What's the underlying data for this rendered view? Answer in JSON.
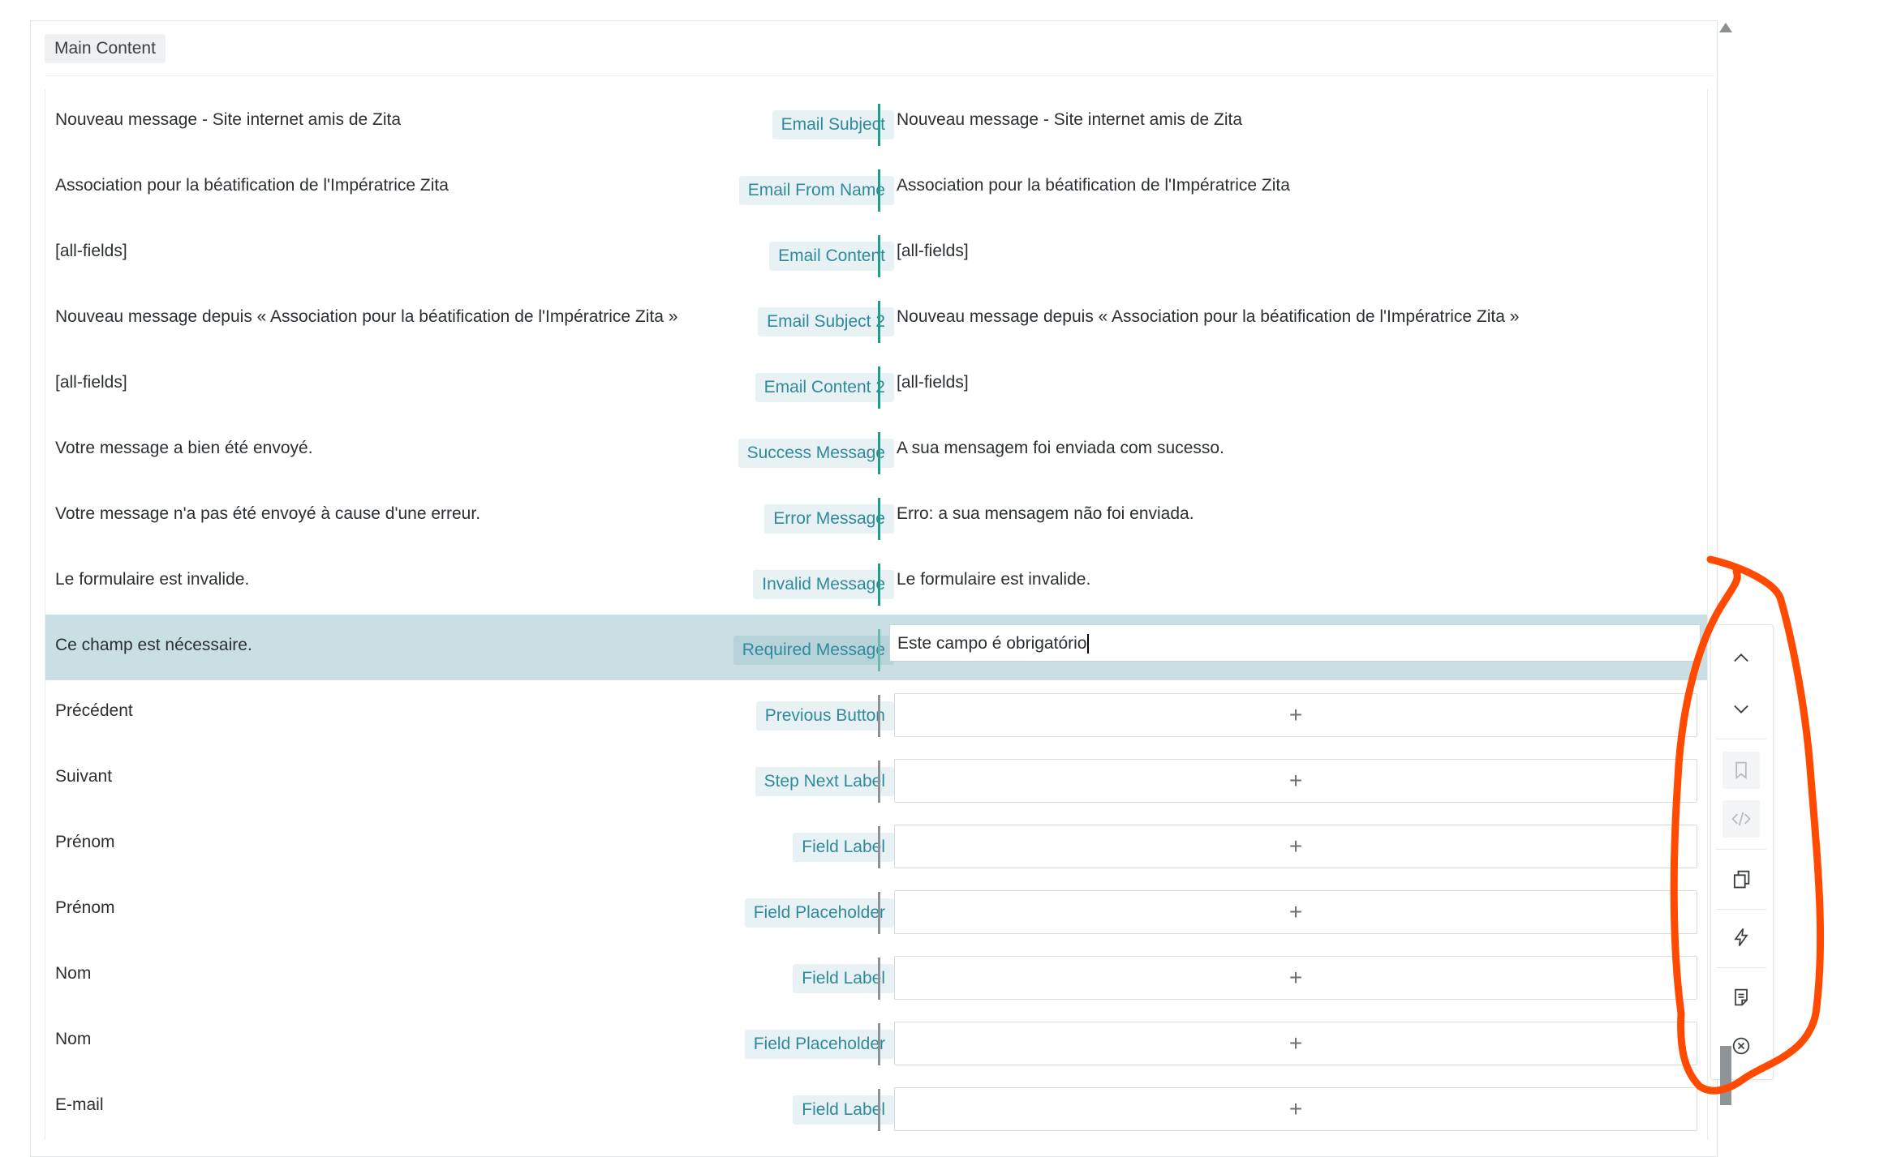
{
  "section": {
    "label": "Main Content"
  },
  "rows": [
    {
      "source": "Nouveau message - Site internet amis de Zita",
      "field": "Email Subject",
      "target": "Nouveau message - Site internet amis de Zita"
    },
    {
      "source": "Association pour la béatification de l'Impératrice Zita",
      "field": "Email From Name",
      "target": "Association pour la béatification de l'Impératrice Zita"
    },
    {
      "source": "[all-fields]",
      "field": "Email Content",
      "target": "[all-fields]"
    },
    {
      "source": "Nouveau message depuis « Association pour la béatification de l'Impératrice Zita »",
      "field": "Email Subject 2",
      "target": "Nouveau message depuis « Association pour la béatification de l'Impératrice Zita »"
    },
    {
      "source": "[all-fields]",
      "field": "Email Content 2",
      "target": "[all-fields]"
    },
    {
      "source": "Votre message a bien été envoyé.",
      "field": "Success Message",
      "target": "A sua mensagem foi enviada com sucesso."
    },
    {
      "source": "Votre message n'a pas été envoyé à cause d'une erreur.",
      "field": "Error Message",
      "target": "Erro: a sua mensagem não foi enviada."
    },
    {
      "source": "Le formulaire est invalide.",
      "field": "Invalid Message",
      "target": "Le formulaire est invalide."
    },
    {
      "source": "Ce champ est nécessaire.",
      "field": "Required Message",
      "target": "Este campo é obrigatório"
    },
    {
      "source": "Précédent",
      "field": "Previous Button",
      "target": "+"
    },
    {
      "source": "Suivant",
      "field": "Step Next Label",
      "target": "+"
    },
    {
      "source": "Prénom",
      "field": "Field Label",
      "target": "+"
    },
    {
      "source": "Prénom",
      "field": "Field Placeholder",
      "target": "+"
    },
    {
      "source": "Nom",
      "field": "Field Label",
      "target": "+"
    },
    {
      "source": "Nom",
      "field": "Field Placeholder",
      "target": "+"
    },
    {
      "source": "E-mail",
      "field": "Field Label",
      "target": "+"
    }
  ],
  "toolbar": {
    "icons": [
      "chevron-up-icon",
      "chevron-down-icon",
      "bookmark-icon",
      "code-icon",
      "copy-icon",
      "lightning-icon",
      "notes-icon",
      "close-circle-icon"
    ]
  },
  "colors": {
    "accent": "#2f8a9c",
    "translated_divider": "#1f9c8c",
    "active_row": "#c9dfe4",
    "annotation": "#ff4a00"
  }
}
